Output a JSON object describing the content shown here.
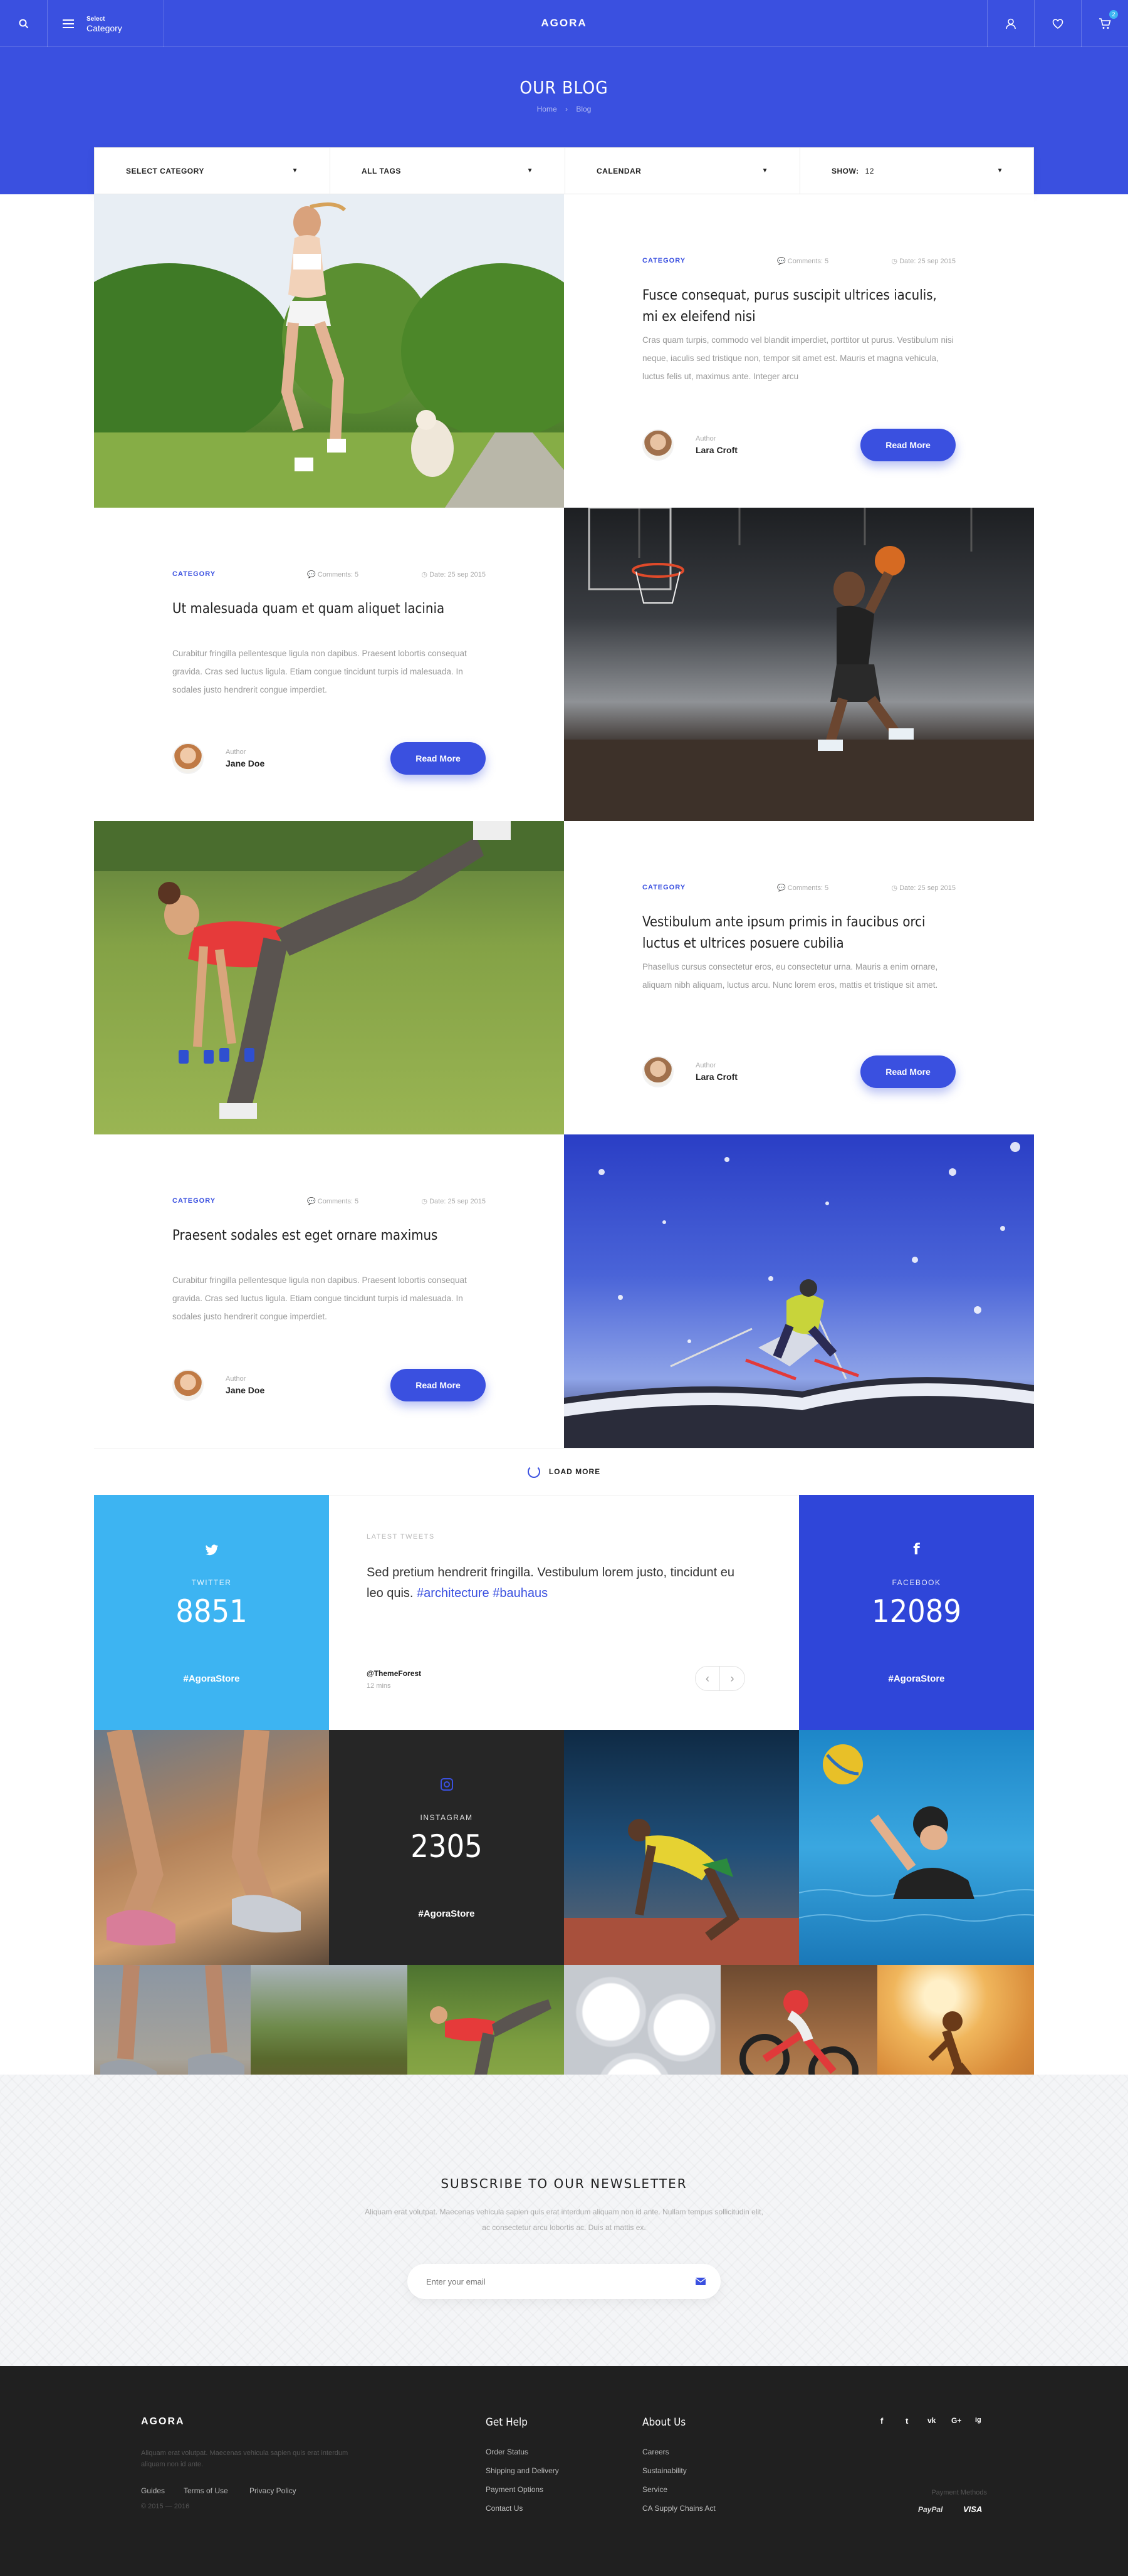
{
  "header": {
    "brand": "AGORA",
    "select_small": "Select",
    "select_label": "Category",
    "cart_count": "2"
  },
  "hero": {
    "title": "OUR BLOG",
    "crumbs": [
      "Home",
      "Blog"
    ]
  },
  "filters": [
    {
      "label": "SELECT CATEGORY"
    },
    {
      "label": "ALL TAGS"
    },
    {
      "label": "CALENDAR"
    },
    {
      "label": "SHOW:",
      "value": "12"
    }
  ],
  "posts": [
    {
      "category": "CATEGORY",
      "comments": "Comments: 5",
      "date": "Date: 25 sep 2015",
      "title": "Fusce consequat, purus suscipit ultrices iaculis, mi ex eleifend nisi",
      "excerpt": "Cras quam turpis, commodo vel blandit imperdiet, porttitor ut purus. Vestibulum nisi neque, iaculis sed tristique non, tempor sit amet est. Mauris et magna vehicula, luctus felis ut, maximus ante. Integer arcu",
      "author_label": "Author",
      "author": "Lara Croft",
      "read_more": "Read More"
    },
    {
      "category": "CATEGORY",
      "comments": "Comments: 5",
      "date": "Date: 25 sep 2015",
      "title": "Ut malesuada quam et quam aliquet lacinia",
      "excerpt": "Curabitur fringilla pellentesque ligula non dapibus. Praesent lobortis consequat gravida. Cras sed luctus ligula. Etiam congue tincidunt turpis id malesuada. In sodales justo hendrerit congue imperdiet.",
      "author_label": "Author",
      "author": "Jane Doe",
      "read_more": "Read More"
    },
    {
      "category": "CATEGORY",
      "comments": "Comments: 5",
      "date": "Date: 25 sep 2015",
      "title": "Vestibulum ante ipsum primis in faucibus orci luctus et ultrices posuere cubilia",
      "excerpt": "Phasellus cursus consectetur eros, eu consectetur urna. Mauris a enim ornare, aliquam nibh aliquam, luctus arcu. Nunc lorem eros, mattis et tristique sit amet.",
      "author_label": "Author",
      "author": "Lara Croft",
      "read_more": "Read More"
    },
    {
      "category": "CATEGORY",
      "comments": "Comments: 5",
      "date": "Date: 25 sep 2015",
      "title": "Praesent sodales est eget ornare maximus",
      "excerpt": "Curabitur fringilla pellentesque ligula non dapibus. Praesent lobortis consequat gravida. Cras sed luctus ligula. Etiam congue tincidunt turpis id malesuada. In sodales justo hendrerit congue imperdiet.",
      "author_label": "Author",
      "author": "Jane Doe",
      "read_more": "Read More"
    }
  ],
  "load_more": "LOAD MORE",
  "social": {
    "twitter": {
      "label": "TWITTER",
      "count": "8851",
      "tag": "#AgoraStore"
    },
    "facebook": {
      "label": "FACEBOOK",
      "count": "12089",
      "tag": "#AgoraStore"
    },
    "instagram": {
      "label": "INSTAGRAM",
      "count": "2305",
      "tag": "#AgoraStore"
    }
  },
  "tweets": {
    "label": "LATEST TWEETS",
    "text": "Sed pretium hendrerit fringilla. Vestibulum lorem justo, tincidunt eu leo quis.",
    "tag1": "#architecture",
    "tag2": "#bauhaus",
    "handle": "@ThemeForest",
    "time": "12 mins"
  },
  "newsletter": {
    "title": "SUBSCRIBE TO OUR NEWSLETTER",
    "text1": "Aliquam erat volutpat. Maecenas vehicula sapien quis erat interdum aliquam non id ante. Nullam tempus sollicitudin elit,",
    "text2": "ac consectetur arcu lobortis ac. Duis at mattis ex.",
    "placeholder": "Enter your email"
  },
  "footer": {
    "brand": "AGORA",
    "about1": "Aliquam erat volutpat. Maecenas vehicula sapien quis erat interdum",
    "about2": "aliquam non id ante.",
    "links_bottom": [
      "Guides",
      "Terms of Use",
      "Privacy Policy"
    ],
    "copyright": "© 2015 — 2016",
    "help_title": "Get Help",
    "help": [
      "Order Status",
      "Shipping and Delivery",
      "Payment Options",
      "Contact Us"
    ],
    "about_title": "About Us",
    "about": [
      "Careers",
      "Sustainability",
      "Service",
      "CA Supply Chains Act"
    ],
    "social_icons": [
      "f",
      "t",
      "vk",
      "G+",
      "ig"
    ],
    "payment_label": "Payment Methods",
    "payments": [
      "PayPal",
      "VISA"
    ]
  },
  "colors": {
    "accent": "#3a50e0",
    "twitter": "#3db4f2",
    "facebook": "#2f46d9",
    "footer": "#202020"
  }
}
